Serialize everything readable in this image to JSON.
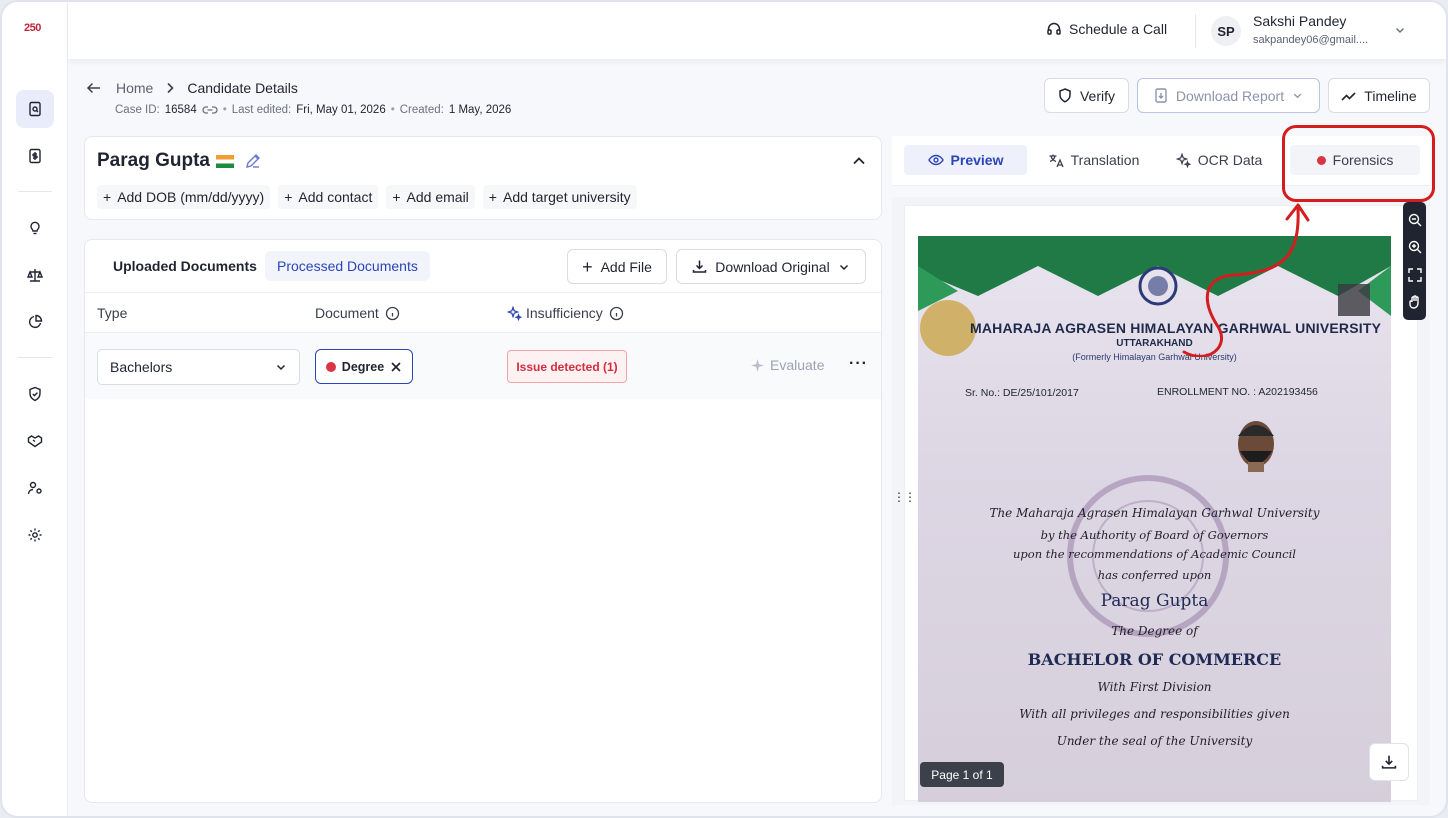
{
  "app": {
    "logo_text": "250"
  },
  "topbar": {
    "schedule_label": "Schedule a Call",
    "user_initials": "SP",
    "user_name": "Sakshi Pandey",
    "user_email": "sakpandey06@gmail...."
  },
  "breadcrumb": {
    "home": "Home",
    "current": "Candidate Details"
  },
  "meta": {
    "case_id_label": "Case ID:",
    "case_id": "16584",
    "last_edited_label": "Last edited:",
    "last_edited": "Fri, May 01, 2026",
    "created_label": "Created:",
    "created": "1 May, 2026"
  },
  "header_buttons": {
    "verify": "Verify",
    "download_report": "Download Report",
    "timeline": "Timeline"
  },
  "candidate": {
    "name": "Parag Gupta",
    "add_dob": "Add DOB (mm/dd/yyyy)",
    "add_contact": "Add contact",
    "add_email": "Add email",
    "add_university": "Add target university"
  },
  "documents": {
    "tab_uploaded": "Uploaded Documents",
    "tab_processed": "Processed Documents",
    "add_file": "Add File",
    "download_original": "Download Original",
    "columns": {
      "type": "Type",
      "document": "Document",
      "insufficiency": "Insufficiency"
    },
    "rows": [
      {
        "type": "Bachelors",
        "document": "Degree",
        "issue": "Issue detected (1)",
        "evaluate": "Evaluate"
      }
    ]
  },
  "preview": {
    "tabs": [
      "Preview",
      "Translation",
      "OCR Data",
      "Forensics"
    ],
    "active_tab": "Preview",
    "page_indicator": "Page 1 of 1",
    "forensics_dot_color": "#d93344"
  },
  "certificate": {
    "university": "MAHARAJA AGRASEN HIMALAYAN GARHWAL UNIVERSITY",
    "state": "UTTARAKHAND",
    "formerly": "(Formerly Himalayan Garhwal University)",
    "serial": "Sr. No.: DE/25/101/2017",
    "enrollment": "ENROLLMENT NO. : A202193456",
    "lines": [
      "The Maharaja Agrasen Himalayan Garhwal University",
      "by the Authority of Board of Governors",
      "upon the recommendations of Academic Council",
      "has conferred upon"
    ],
    "recipient": "Parag Gupta",
    "degree_intro": "The Degree of",
    "degree": "BACHELOR OF COMMERCE",
    "division": "With First Division",
    "privileges": "With all privileges and responsibilities given",
    "seal_line": "Under the seal of the University"
  },
  "colors": {
    "accent": "#2c44b8",
    "annotation": "#d41d1d",
    "issue_red": "#d42d3e"
  }
}
